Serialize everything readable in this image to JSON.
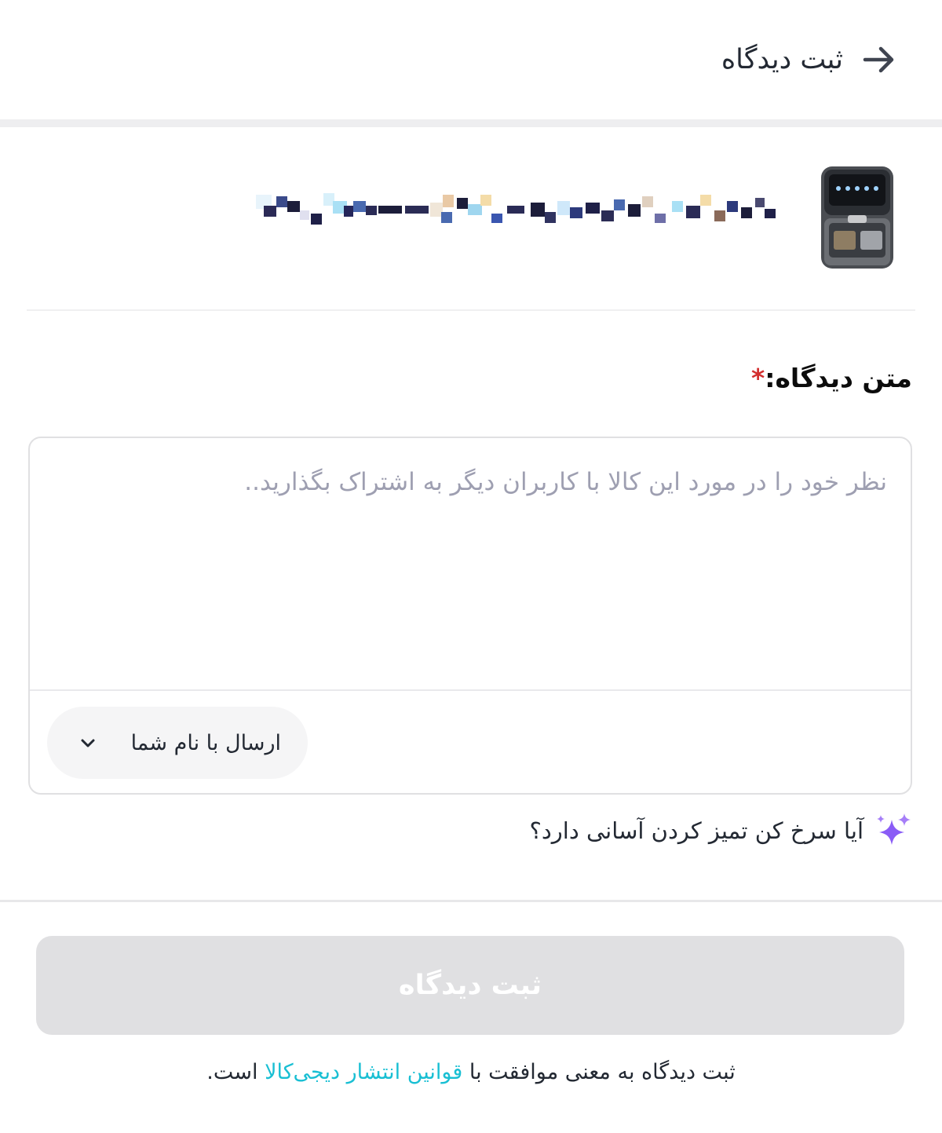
{
  "header": {
    "title": "ثبت دیدگاه",
    "back_icon": "arrow-right-icon"
  },
  "product": {
    "thumbnail_icon": "air-fryer-image",
    "name_obscured": true
  },
  "comment": {
    "label": "متن دیدگاه:",
    "required_mark": "*",
    "placeholder": "نظر خود را در مورد این کالا با کاربران دیگر به اشتراک بگذارید..",
    "value": "",
    "sender_option": "ارسال با نام شما"
  },
  "ai_suggestion": {
    "icon": "sparkles-icon",
    "text": "آیا سرخ کن تمیز کردن آسانی دارد؟"
  },
  "submit": {
    "label": "ثبت دیدگاه",
    "enabled": false
  },
  "terms": {
    "prefix": "ثبت دیدگاه به معنی موافقت با ",
    "link_text": "قوانین انتشار دیجی‌کالا",
    "suffix": " است."
  },
  "colors": {
    "accent_link": "#19bfd3",
    "required": "#d32f2f",
    "disabled_button": "#e0e0e2",
    "sparkle": "#8a5cf6"
  }
}
